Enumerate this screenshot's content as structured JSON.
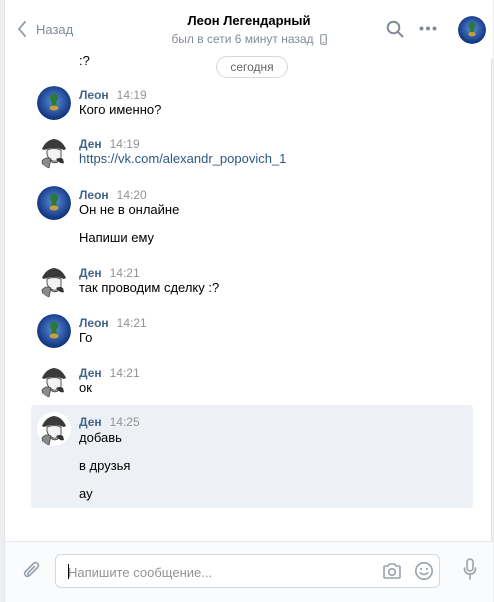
{
  "header": {
    "back_label": "Назад",
    "title": "Леон Легендарный",
    "status": "был в сети 6 минут назад"
  },
  "messages_area": {
    "previous_text": ":?",
    "date_separator": "сегодня"
  },
  "messages": [
    {
      "author": "Леон",
      "time": "14:19",
      "lines": [
        "Кого именно?"
      ]
    },
    {
      "author": "Ден",
      "time": "14:19",
      "lines": [
        "https://vk.com/alexandr_popovich_1"
      ]
    },
    {
      "author": "Леон",
      "time": "14:20",
      "lines": [
        "Он не в онлайне",
        "Напиши ему"
      ]
    },
    {
      "author": "Ден",
      "time": "14:21",
      "lines": [
        "так проводим сделку :?"
      ]
    },
    {
      "author": "Леон",
      "time": "14:21",
      "lines": [
        "Го"
      ]
    },
    {
      "author": "Ден",
      "time": "14:21",
      "lines": [
        "ок"
      ]
    },
    {
      "author": "Ден",
      "time": "14:25",
      "lines": [
        "добавь",
        "в друзья",
        "ау"
      ]
    }
  ],
  "composer": {
    "placeholder": "Напишите сообщение..."
  },
  "icons": {
    "back": "chevron-left-icon",
    "search": "search-icon",
    "more": "more-horizontal-icon",
    "phone": "mobile-phone-icon",
    "attach": "paperclip-icon",
    "camera": "camera-icon",
    "emoji": "smile-icon",
    "voice": "microphone-icon"
  },
  "colors": {
    "author": "#42648b",
    "link": "#2a5885",
    "muted": "#818c99",
    "highlight": "#edf0f5"
  }
}
